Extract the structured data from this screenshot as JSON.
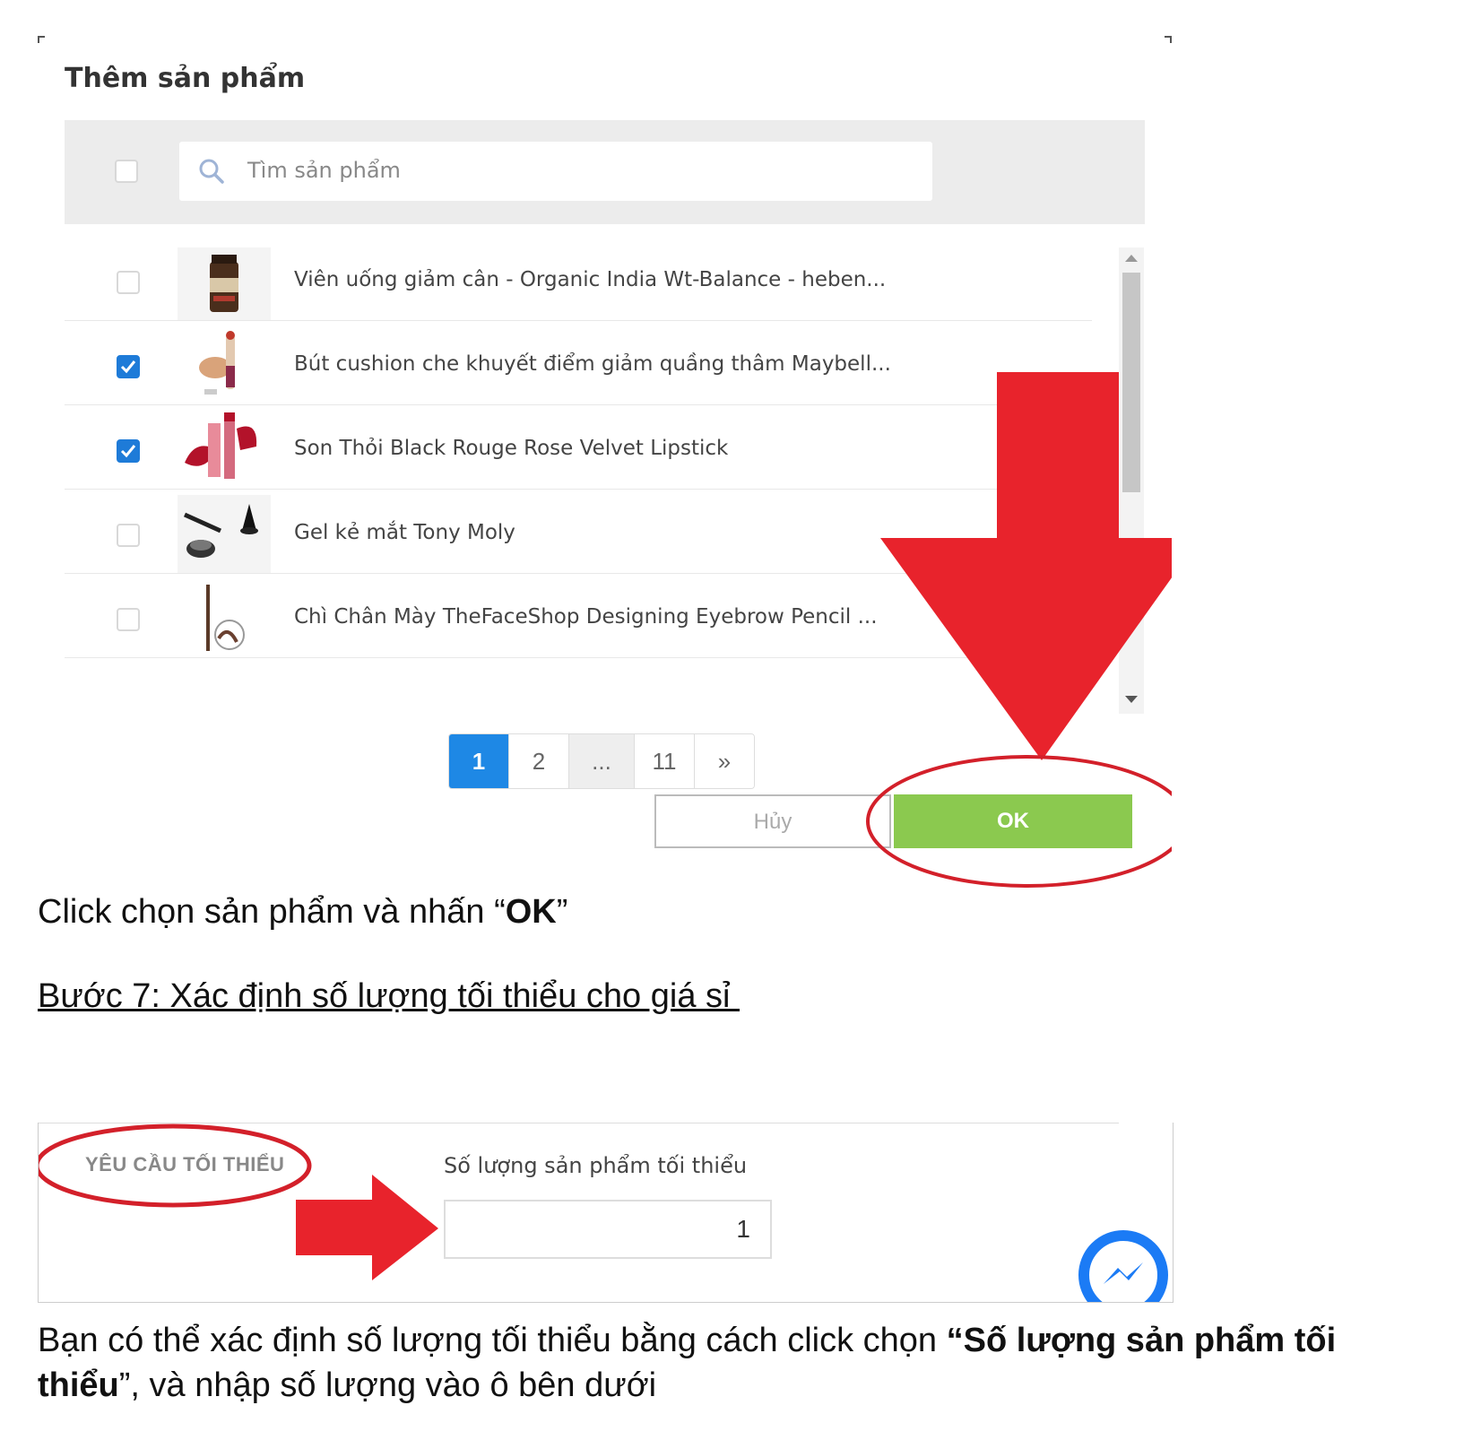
{
  "dialog": {
    "title": "Thêm sản phẩm",
    "search_placeholder": "Tìm sản phẩm",
    "products": [
      {
        "label": "Viên uống giảm cân - Organic India Wt-Balance - heben...",
        "checked": false,
        "thumb": "supplement-bottle-icon"
      },
      {
        "label": "Bút cushion che khuyết điểm giảm quầng thâm Maybell...",
        "checked": true,
        "thumb": "concealer-icon"
      },
      {
        "label": "Son Thỏi Black Rouge Rose Velvet Lipstick",
        "checked": true,
        "thumb": "lipstick-icon"
      },
      {
        "label": "Gel kẻ mắt Tony Moly",
        "checked": false,
        "thumb": "eyeliner-gel-icon"
      },
      {
        "label": "Chì Chân Mày TheFaceShop Designing Eyebrow Pencil ...",
        "checked": false,
        "thumb": "eyebrow-pencil-icon"
      }
    ],
    "pagination": [
      "1",
      "2",
      "...",
      "11",
      "»"
    ],
    "active_page": "1",
    "cancel_label": "Hủy",
    "ok_label": "OK"
  },
  "caption1": {
    "prefix": "Click chọn sản phẩm và nhấn “",
    "bold": "OK",
    "suffix": "”"
  },
  "step7_heading": "Bước 7: Xác định số lượng tối thiểu cho giá sỉ ",
  "min_req": {
    "section_label": "YÊU CẦU TỐI THIỂU",
    "field_label": "Số lượng sản phẩm tối thiểu",
    "field_value": "1"
  },
  "caption2": {
    "prefix": "Bạn có thể xác định số lượng tối thiểu bằng cách click chọn ",
    "bold": "“Số lượng sản phẩm tối thiểu",
    "suffix": "”, và nhập số lượng vào ô bên dưới"
  },
  "colors": {
    "primary_blue": "#1e88e5",
    "ok_green": "#8bc94f",
    "annotation_red": "#e8232c",
    "messenger_blue": "#1b7bf5"
  }
}
